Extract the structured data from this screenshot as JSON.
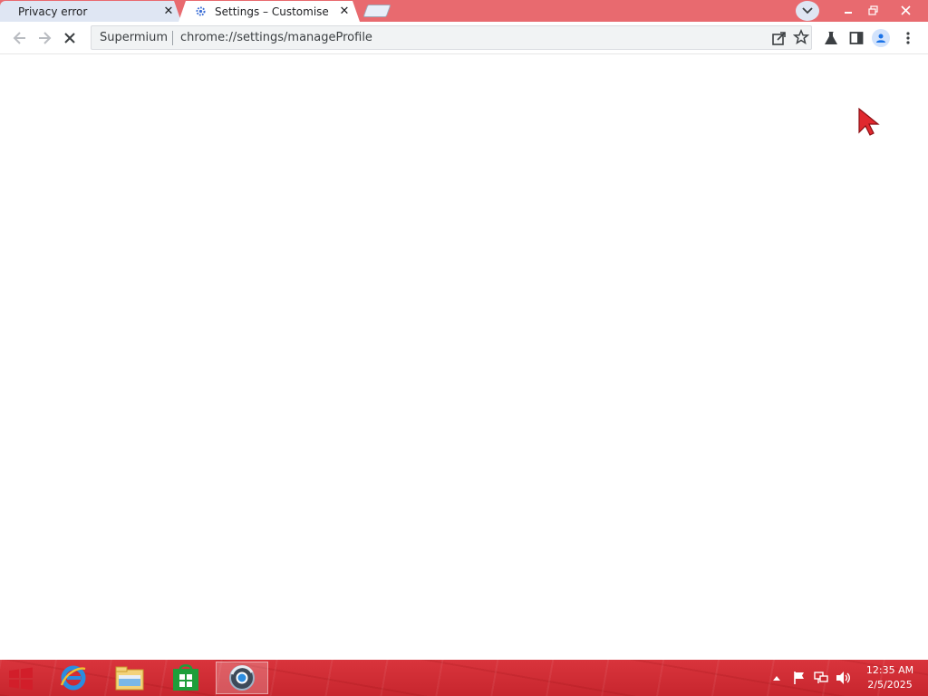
{
  "browser": {
    "tabs": [
      {
        "title": "Privacy error",
        "active": false
      },
      {
        "title": "Settings – Customise pr",
        "active": true
      }
    ],
    "omnibox": {
      "chip": "Supermium",
      "url": "chrome://settings/manageProfile"
    }
  },
  "taskbar": {
    "apps": [
      "internet-explorer-icon",
      "file-explorer-icon",
      "store-icon",
      "browser-icon"
    ],
    "clock": {
      "time": "12:35 AM",
      "date": "2/5/2025"
    }
  },
  "colors": {
    "titlebar": "#e86a6f",
    "taskbar": "#d9343c",
    "cursor": "#e0282e"
  }
}
